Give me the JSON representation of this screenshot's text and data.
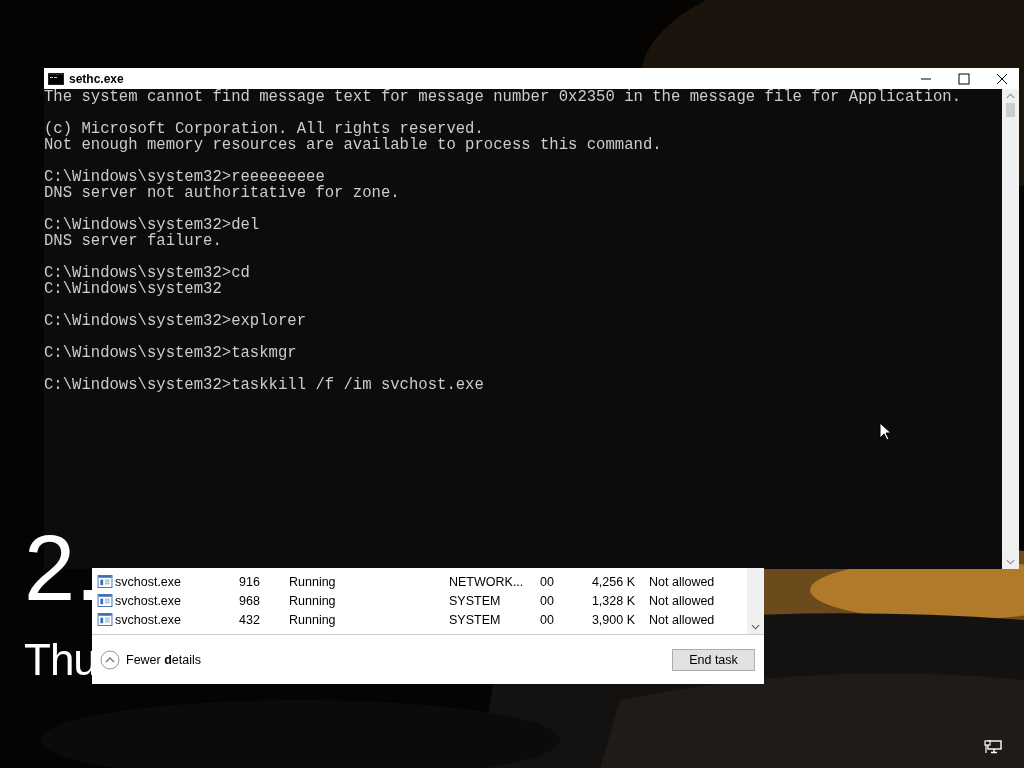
{
  "lock_screen": {
    "time": "2.",
    "date": "Thu"
  },
  "console": {
    "title": "sethc.exe",
    "blocks": [
      [
        "The system cannot find message text for message number 0x2350 in the message file for Application."
      ],
      [
        "(c) Microsoft Corporation. All rights reserved.",
        "Not enough memory resources are available to process this command."
      ],
      [
        "C:\\Windows\\system32>reeeeeeeee",
        "DNS server not authoritative for zone."
      ],
      [
        "C:\\Windows\\system32>del",
        "DNS server failure."
      ],
      [
        "C:\\Windows\\system32>cd",
        "C:\\Windows\\system32"
      ],
      [
        "C:\\Windows\\system32>explorer"
      ],
      [
        "C:\\Windows\\system32>taskmgr"
      ],
      [
        "C:\\Windows\\system32>taskkill /f /im svchost.exe"
      ]
    ]
  },
  "task_manager": {
    "rows": [
      {
        "name": "svchost.exe",
        "pid": "916",
        "status": "Running",
        "user": "NETWORK...",
        "cpu": "00",
        "memory": "4,256 K",
        "uac": "Not allowed"
      },
      {
        "name": "svchost.exe",
        "pid": "968",
        "status": "Running",
        "user": "SYSTEM",
        "cpu": "00",
        "memory": "1,328 K",
        "uac": "Not allowed"
      },
      {
        "name": "svchost.exe",
        "pid": "432",
        "status": "Running",
        "user": "SYSTEM",
        "cpu": "00",
        "memory": "3,900 K",
        "uac": "Not allowed"
      }
    ],
    "fewer_details": "Fewer **d**etails",
    "end_task": "End task"
  }
}
